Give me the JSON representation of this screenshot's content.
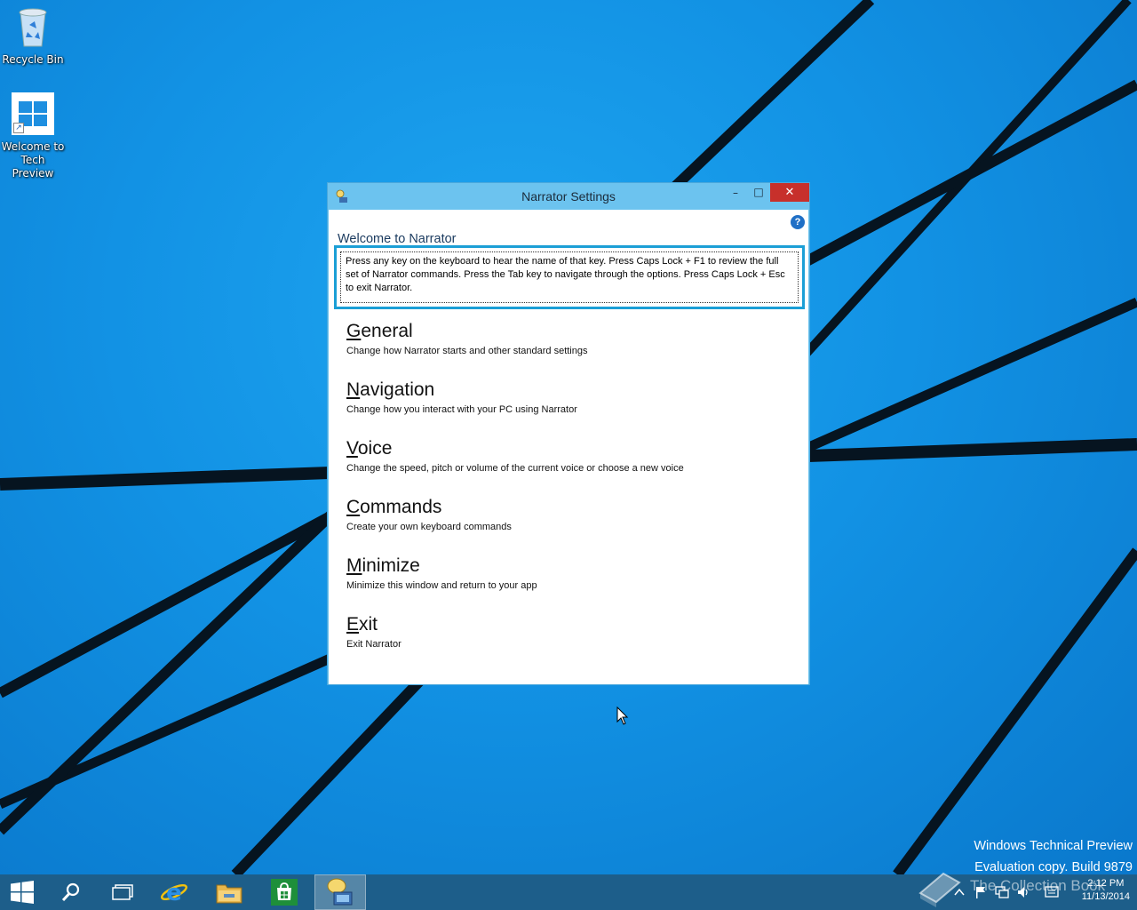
{
  "desktop": {
    "icons": [
      {
        "label": "Recycle Bin",
        "icon": "recycle-bin-icon"
      },
      {
        "label": "Welcome to Tech Preview",
        "icon": "windows-logo-icon"
      }
    ]
  },
  "window": {
    "title": "Narrator Settings",
    "caption_buttons": {
      "minimize": "–",
      "maximize": "□",
      "close": "✕"
    },
    "help_glyph": "?",
    "heading": "Welcome to Narrator",
    "intro": "Press any key on the keyboard to hear the name of that key.  Press Caps Lock + F1 to review the full set of Narrator commands.  Press the Tab key to navigate through the options.  Press Caps Lock + Esc to exit Narrator.",
    "menu": [
      {
        "accel": "G",
        "rest": "eneral",
        "desc": "Change how Narrator starts and other standard settings"
      },
      {
        "accel": "N",
        "rest": "avigation",
        "desc": "Change how you interact with your PC using Narrator"
      },
      {
        "accel": "V",
        "rest": "oice",
        "desc": "Change the speed, pitch or volume of the current voice or choose a new voice"
      },
      {
        "accel": "C",
        "rest": "ommands",
        "desc": "Create your own keyboard commands"
      },
      {
        "accel": "M",
        "rest": "inimize",
        "desc": "Minimize this window and return to your app"
      },
      {
        "accel": "E",
        "rest": "xit",
        "desc": "Exit Narrator"
      }
    ]
  },
  "watermark": {
    "line1": "Windows Technical Preview",
    "line2": "Evaluation copy. Build 9879",
    "collection": "The Collection Book"
  },
  "taskbar": {
    "buttons": [
      "start-icon",
      "search-icon",
      "task-view-icon",
      "internet-explorer-icon",
      "file-explorer-icon",
      "store-icon",
      "narrator-icon"
    ],
    "clock": {
      "time": "2:12 PM",
      "date": "11/13/2014"
    }
  },
  "colors": {
    "desktop": "#1292e4",
    "titlebar": "#6cc3ef",
    "close": "#c7302b",
    "focus_border": "#1b9fd6"
  }
}
